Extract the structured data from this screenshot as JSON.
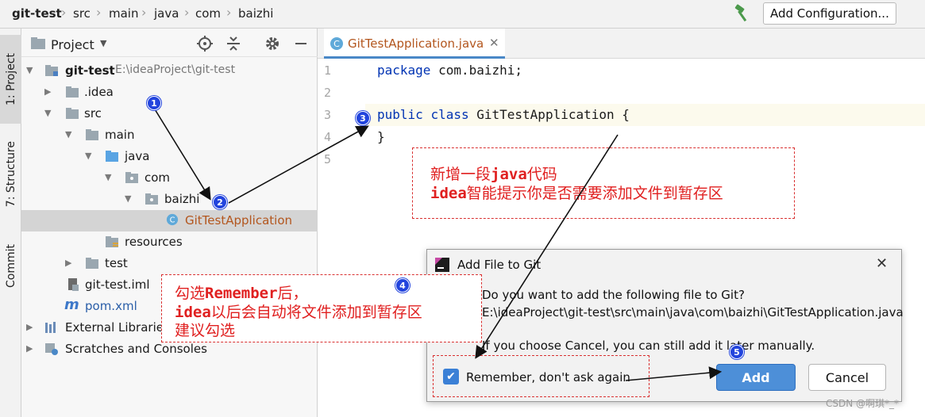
{
  "breadcrumb": {
    "items": [
      "git-test",
      "src",
      "main",
      "java",
      "com",
      "baizhi"
    ]
  },
  "toolbar": {
    "config_label": "Add Configuration..."
  },
  "side_strip": {
    "project_tab": "1: Project",
    "structure_tab": "7: Structure",
    "commit_tab": "Commit"
  },
  "project_panel": {
    "title": "Project",
    "tree": [
      {
        "label": "git-test",
        "path": "E:\\ideaProject\\git-test"
      },
      {
        "label": ".idea"
      },
      {
        "label": "src"
      },
      {
        "label": "main"
      },
      {
        "label": "java"
      },
      {
        "label": "com"
      },
      {
        "label": "baizhi"
      },
      {
        "label": "GitTestApplication"
      },
      {
        "label": "resources"
      },
      {
        "label": "test"
      },
      {
        "label": "git-test.iml"
      },
      {
        "label": "pom.xml"
      },
      {
        "label": "External Libraries"
      },
      {
        "label": "Scratches and Consoles"
      }
    ]
  },
  "editor": {
    "tab_label": "GitTestApplication.java",
    "line_numbers": [
      "1",
      "2",
      "3",
      "4",
      "5"
    ],
    "code": {
      "line1_kw": "package",
      "line1_rest": " com.baizhi;",
      "line3_kw1": "public",
      "line3_kw2": "class",
      "line3_rest": " GitTestApplication {",
      "line4": "}"
    }
  },
  "callouts": {
    "top_line1_a": "新增一段",
    "top_line1_mono": "java",
    "top_line1_b": "代码",
    "top_line2_mono": "idea",
    "top_line2_b": "智能提示你是否需要添加文件到暂存区",
    "left_line1_a": "勾选",
    "left_line1_mono": "Remember",
    "left_line1_b": "后，",
    "left_line2_mono": "idea",
    "left_line2_b": "以后会自动将文件添加到暂存区",
    "left_line3": "建议勾选"
  },
  "badges": [
    "1",
    "2",
    "3",
    "4",
    "5"
  ],
  "dialog": {
    "title": "Add File to Git",
    "question": "Do you want to add the following file to Git?",
    "file_path": "E:\\ideaProject\\git-test\\src\\main\\java\\com\\baizhi\\GitTestApplication.java",
    "hint": "If you choose Cancel, you can still add it later manually.",
    "remember_label": "Remember, don't ask again",
    "remember_checked": true,
    "add_label": "Add",
    "cancel_label": "Cancel",
    "question_icon": "?"
  },
  "watermark": "CSDN @啊琪*_*",
  "colors": {
    "accent": "#4d8fd8",
    "badge": "#2244dd",
    "callout_red": "#e02020",
    "java_file": "#b3561e"
  }
}
